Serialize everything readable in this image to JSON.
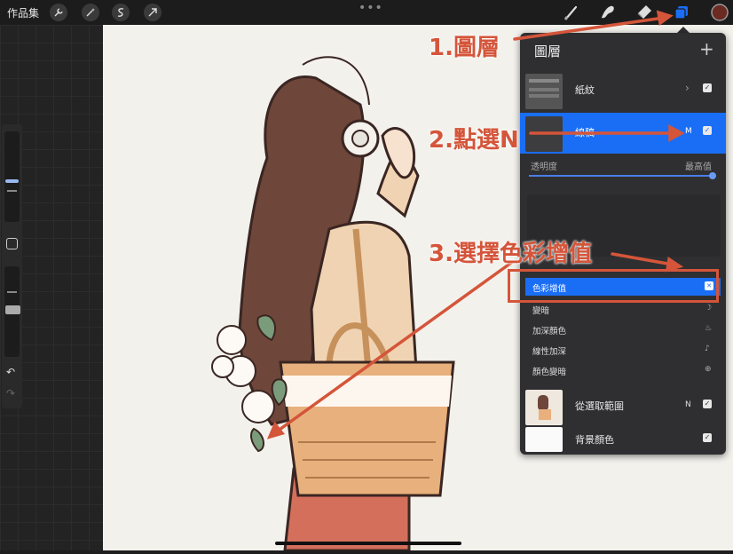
{
  "topbar": {
    "gallery_label": "作品集",
    "left_tools": [
      "wrench-icon",
      "magic-wand-icon",
      "selection-icon",
      "transform-arrow-icon"
    ],
    "more_dots": "•••",
    "right_tools": [
      "brush-icon",
      "smudge-icon",
      "eraser-icon",
      "layers-icon",
      "color-icon"
    ],
    "active_color": "#6b2a22"
  },
  "layers_panel": {
    "title": "圖層",
    "add_label": "+",
    "layers": [
      {
        "name": "紙紋",
        "mode": "",
        "checked": true,
        "expandable": true
      },
      {
        "name": "線稿",
        "mode": "M",
        "checked": true,
        "selected": true
      },
      {
        "name": "從選取範圍",
        "mode": "N",
        "checked": true
      },
      {
        "name": "背景顏色",
        "mode": "",
        "checked": true
      }
    ],
    "opacity_label": "透明度",
    "opacity_value": "最高值",
    "opacity_level": 1.0,
    "blend_modes": [
      "色彩增值",
      "變暗",
      "加深顏色",
      "線性加深",
      "顏色變暗"
    ],
    "selected_blend": "色彩增值"
  },
  "annotations": {
    "step1": "1.圖層",
    "step2": "2.點選N",
    "step3": "3.選擇色彩增值",
    "color": "#d4553a"
  },
  "colors": {
    "accent": "#1a6ef5",
    "panel_bg": "#2f2f31",
    "canvas_bg": "#f3f1ec"
  }
}
